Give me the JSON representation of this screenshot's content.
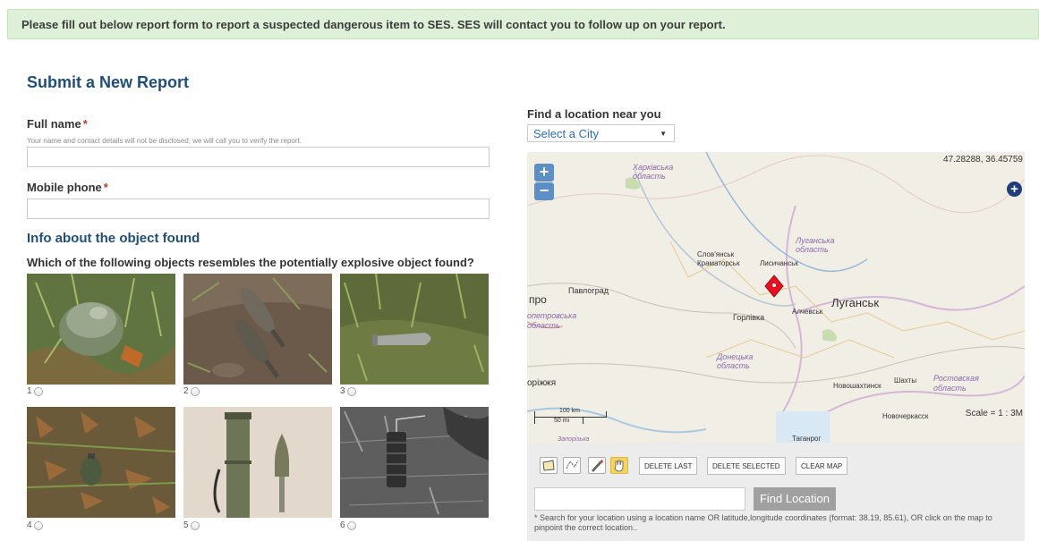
{
  "notice": {
    "text_before": "Please fill out below report form to report a suspected dangerous item to ",
    "ses_1": "SES",
    "text_mid": ". ",
    "ses_2": "SES",
    "text_after": " will contact you to follow up on your report."
  },
  "form": {
    "title": "Submit a New Report",
    "full_name_label": "Full name",
    "required_mark": "*",
    "full_name_hint": "Your name and contact details will not be disclosed, we will call you to verify the report.",
    "mobile_label": "Mobile phone",
    "section_title": "Info about the object found",
    "question": "Which of the following objects resembles the potentially explosive object found?",
    "objects": [
      "1",
      "2",
      "3",
      "4",
      "5",
      "6"
    ]
  },
  "location": {
    "label": "Find a location near you",
    "city_select": "Select a City",
    "map": {
      "coords": "47.28288, 36.45759",
      "scale": "Scale = 1 : 3M",
      "scale_km": "100 km",
      "scale_mi": "50 mi",
      "labels": {
        "kharkiv_1": "Харківська",
        "kharkiv_2": "область",
        "luhansk_obl_1": "Луганська",
        "luhansk_obl_2": "область",
        "slovyansk": "Слов'янськ",
        "kramatorsk": "Краматорськ",
        "lysychansk": "Лисичанськ",
        "pavlohrad": "Павлоград",
        "dnipro_part": "про",
        "dnipro_obl_1": "опетровська",
        "dnipro_obl_2": "область",
        "luhansk": "Луганськ",
        "alchevsk": "Алчевськ",
        "horlivka": "Горлівка",
        "donetsk_obl_1": "Донецька",
        "donetsk_obl_2": "область",
        "zaporizhzhia": "оріжжя",
        "novoshakhtinsk": "Новошахтинск",
        "shakhty": "Шахты",
        "rostov_obl_1": "Ростовская",
        "rostov_obl_2": "область",
        "novocherkassk": "Новочеркасск",
        "taganrog": "Таганрог",
        "zaporizhzhia_obl": "Запорізька"
      }
    },
    "buttons": {
      "delete_last": "DELETE LAST",
      "delete_selected": "DELETE SELECTED",
      "clear_map": "CLEAR MAP",
      "find_location": "Find Location"
    },
    "help": "* Search for your location using a location name OR latitude,longitude coordinates (format: 38.19, 85.61), OR click on the map to pinpoint the correct location.."
  },
  "colors": {
    "notice_bg": "#dff0d8",
    "heading": "#1f4e79",
    "required": "#c0392b",
    "marker": "#e8101e",
    "link": "#2a6ebb"
  },
  "icons": [
    "plus-icon",
    "minus-icon",
    "map-marker-icon",
    "layer-switcher-icon",
    "draw-polygon-icon",
    "draw-line-icon",
    "edit-icon",
    "pan-hand-icon"
  ]
}
